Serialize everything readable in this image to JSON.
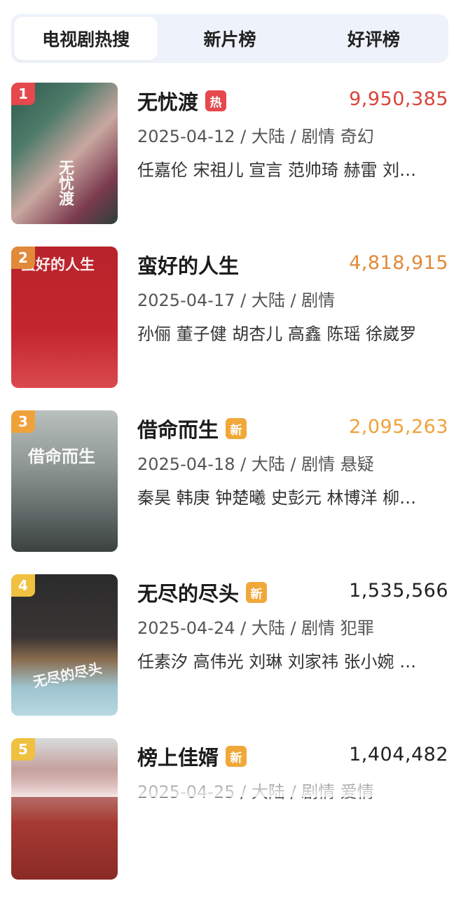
{
  "tabs": [
    {
      "label": "电视剧热搜",
      "active": true
    },
    {
      "label": "新片榜",
      "active": false
    },
    {
      "label": "好评榜",
      "active": false
    }
  ],
  "colors": {
    "hot_badge": "#e5484d",
    "new_badge": "#f0a83a",
    "score_rank1": "#d9443a",
    "score_rank2": "#e08a3a",
    "score_rank3": "#f0a23a",
    "score_default": "#222222"
  },
  "items": [
    {
      "rank": "1",
      "title": "无忧渡",
      "badge": "热",
      "badge_type": "hot",
      "score": "9,950,385",
      "meta": "2025-04-12 / 大陆 / 剧情 奇幻",
      "cast": "任嘉伦 宋祖儿 宣言 范帅琦 赫雷 刘…",
      "poster_text": "无忧渡"
    },
    {
      "rank": "2",
      "title": "蛮好的人生",
      "badge": "",
      "badge_type": "none",
      "score": "4,818,915",
      "meta": "2025-04-17 / 大陆 / 剧情",
      "cast": "孙俪 董子健 胡杏儿 高鑫 陈瑶 徐崴罗",
      "poster_text": "蛮好的人生"
    },
    {
      "rank": "3",
      "title": "借命而生",
      "badge": "新",
      "badge_type": "new",
      "score": "2,095,263",
      "meta": "2025-04-18 / 大陆 / 剧情 悬疑",
      "cast": "秦昊 韩庚 钟楚曦 史彭元 林博洋 柳…",
      "poster_text": "借命而生"
    },
    {
      "rank": "4",
      "title": "无尽的尽头",
      "badge": "新",
      "badge_type": "new",
      "score": "1,535,566",
      "meta": "2025-04-24 / 大陆 / 剧情 犯罪",
      "cast": "任素汐 高伟光 刘琳 刘家祎 张小婉 …",
      "poster_text": "无尽的尽头"
    },
    {
      "rank": "5",
      "title": "榜上佳婿",
      "badge": "新",
      "badge_type": "new",
      "score": "1,404,482",
      "meta": "2025-04-25 / 大陆 / 剧情 爱情",
      "cast": "",
      "poster_text": ""
    }
  ]
}
